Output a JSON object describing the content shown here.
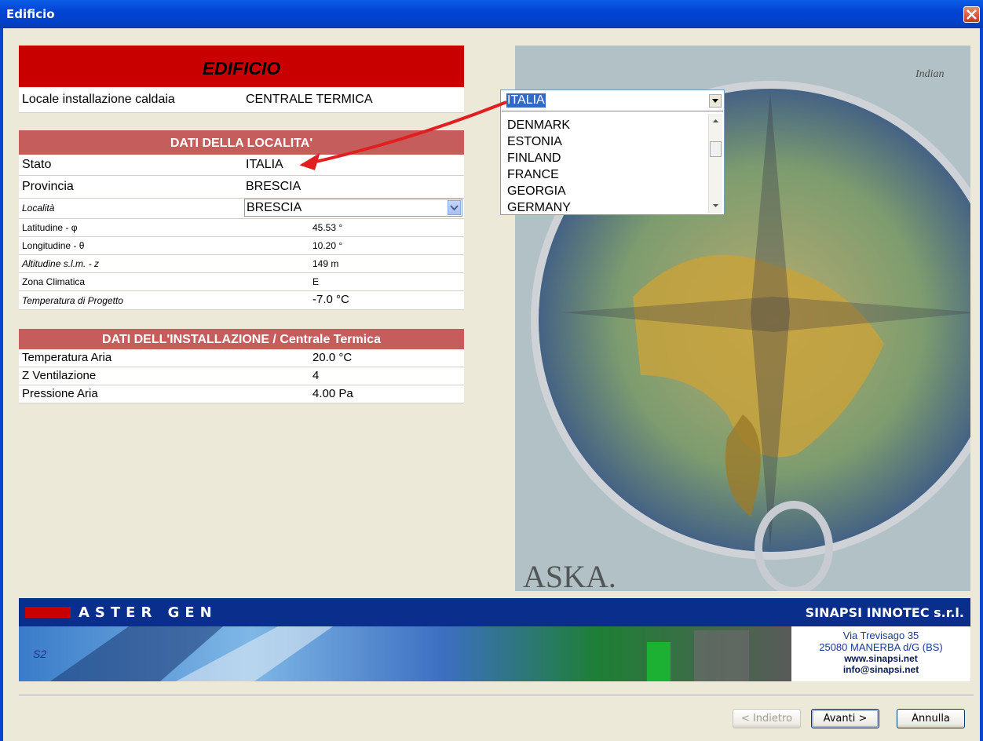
{
  "window": {
    "title": "Edificio"
  },
  "edificio": {
    "header": "EDIFICIO",
    "locale_label": "Locale installazione caldaia",
    "locale_value": "CENTRALE TERMICA"
  },
  "localita": {
    "header": "DATI DELLA LOCALITA'",
    "stato_label": "Stato",
    "stato_value": "ITALIA",
    "provincia_label": "Provincia",
    "provincia_value": "BRESCIA",
    "localita_label": "Località",
    "localita_value": "BRESCIA",
    "latitudine_label": "Latitudine - φ",
    "latitudine_value": "45.53 °",
    "longitudine_label": "Longitudine - θ",
    "longitudine_value": "10.20 °",
    "altitudine_label": "Altitudine s.l.m. - z",
    "altitudine_value": "149 m",
    "zona_label": "Zona Climatica",
    "zona_value": "E",
    "temp_label": "Temperatura di Progetto",
    "temp_value": "-7.0 °C"
  },
  "installazione": {
    "header": "DATI DELL'INSTALLAZIONE / Centrale Termica",
    "temp_aria_label": "Temperatura Aria",
    "temp_aria_value": "20.0 °C",
    "ventilazione_label": "Z Ventilazione",
    "ventilazione_value": "4",
    "pressione_label": "Pressione Aria",
    "pressione_value": "4.00 Pa"
  },
  "dropdown": {
    "selected": "ITALIA",
    "options": [
      "DENMARK",
      "ESTONIA",
      "FINLAND",
      "FRANCE",
      "GEORGIA",
      "GERMANY"
    ]
  },
  "banner": {
    "product": "ASTER GEN",
    "company": "SINAPSI INNOTEC s.r.l.",
    "address1": "Via Trevisago 35",
    "address2": "25080 MANERBA d/G (BS)",
    "web": "www.sinapsi.net",
    "email": "info@sinapsi.net"
  },
  "buttons": {
    "back": "< Indietro",
    "next": "Avanti >",
    "cancel": "Annulla"
  }
}
